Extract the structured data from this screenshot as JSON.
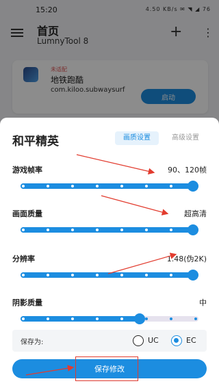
{
  "status_bar": {
    "time": "15:20",
    "icons_text": "4.50 KB/s ✉ ◥ ◢ 76"
  },
  "app_bar": {
    "title": "首页",
    "subtitle": "LumnyTool 8",
    "add_icon": "plus-icon",
    "more_icon": "more-vert-icon"
  },
  "game_card": {
    "badge": "未适配",
    "name": "地铁跑酷",
    "package": "com.kiloo.subwaysurf",
    "launch_label": "启动"
  },
  "sheet": {
    "title": "和平精英",
    "tabs": [
      {
        "label": "画质设置",
        "active": true
      },
      {
        "label": "高级设置",
        "active": false
      }
    ],
    "settings": [
      {
        "label": "游戏帧率",
        "value": "90、120帧",
        "level": 1.0,
        "stops": 8
      },
      {
        "label": "画面质量",
        "value": "超高清",
        "level": 1.0,
        "stops": 8
      },
      {
        "label": "分辨率",
        "value": "1.48(伪2K)",
        "level": 1.0,
        "stops": 8
      },
      {
        "label": "阴影质量",
        "value": "中",
        "level": 0.67,
        "stops": 8
      }
    ],
    "save_as": {
      "label": "保存为:",
      "options": [
        {
          "label": "UC",
          "checked": false
        },
        {
          "label": "EC",
          "checked": true
        }
      ]
    },
    "save_button": "保存修改"
  },
  "colors": {
    "accent": "#1c8de0",
    "track": "#e6e2ee",
    "annotation": "#e23b2e"
  }
}
